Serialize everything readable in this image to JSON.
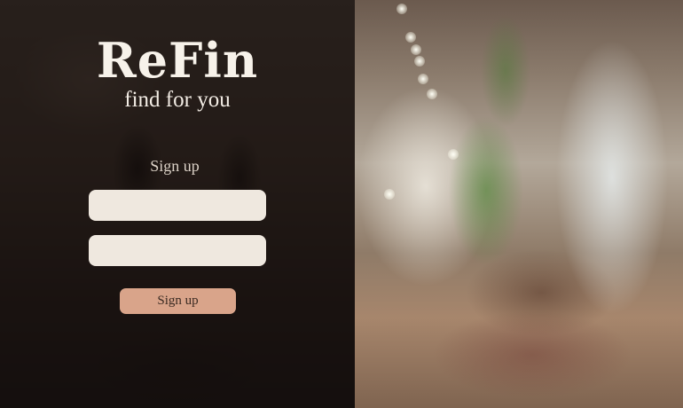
{
  "brand": {
    "logo_text": "ReFin",
    "tagline": "find for you"
  },
  "signup_form": {
    "title": "Sign up",
    "field_1": {
      "value": "",
      "placeholder": ""
    },
    "field_2": {
      "value": "",
      "placeholder": ""
    },
    "submit_label": "Sign up"
  },
  "colors": {
    "panel_overlay": "#0c0908",
    "input_background": "#efe8df",
    "button_background": "#d9a48a",
    "text_light": "#f7f2ea"
  }
}
